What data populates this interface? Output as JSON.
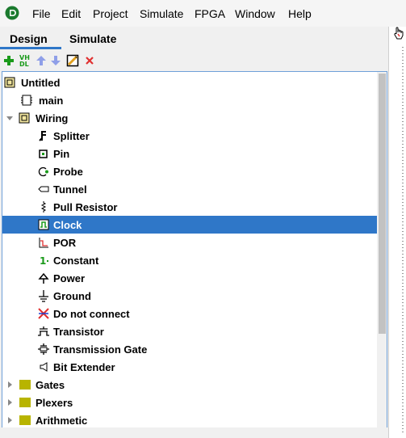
{
  "menu": [
    "File",
    "Edit",
    "Project",
    "Simulate",
    "FPGA",
    "Window",
    "Help"
  ],
  "tabs": {
    "design": "Design",
    "simulate": "Simulate"
  },
  "toolbar": {
    "vhdl_line1": "VH",
    "vhdl_line2": "DL"
  },
  "tree": {
    "project": "Untitled",
    "main": "main",
    "wiring": {
      "label": "Wiring",
      "items": [
        "Splitter",
        "Pin",
        "Probe",
        "Tunnel",
        "Pull Resistor",
        "Clock",
        "POR",
        "Constant",
        "Power",
        "Ground",
        "Do not connect",
        "Transistor",
        "Transmission Gate",
        "Bit Extender"
      ]
    },
    "gates": "Gates",
    "plexers": "Plexers",
    "arithmetic": "Arithmetic",
    "constant_icon_text": "1"
  },
  "colors": {
    "selection": "#2f77c8",
    "add": "#1a9a1a",
    "delete": "#e03030",
    "folder": "#b8b400"
  }
}
